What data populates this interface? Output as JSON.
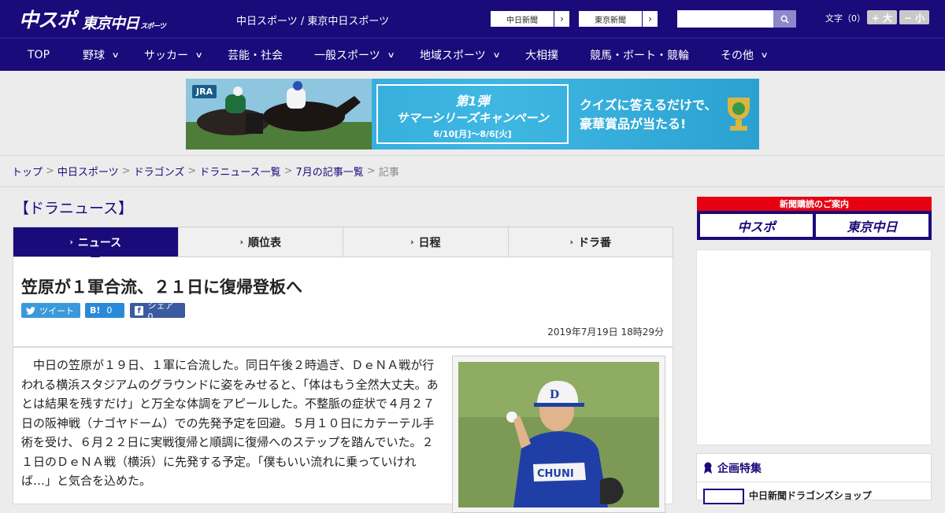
{
  "header": {
    "logo_main": "中スポ",
    "logo_sub": "東京中日",
    "logo_sub_small": "スポーツ",
    "site_names": "中日スポーツ / 東京中日スポーツ",
    "paper_buttons": [
      "中日新聞",
      "東京新聞"
    ],
    "search": {
      "placeholder": ""
    },
    "fontsize_label": "文字（0）",
    "fontsize_larger": "+ 大",
    "fontsize_smaller": "− 小"
  },
  "nav": [
    {
      "label": "TOP",
      "has_menu": false
    },
    {
      "label": "野球",
      "has_menu": true
    },
    {
      "label": "サッカー",
      "has_menu": true
    },
    {
      "label": "芸能・社会",
      "has_menu": false
    },
    {
      "label": "一般スポーツ",
      "has_menu": true
    },
    {
      "label": "地域スポーツ",
      "has_menu": true
    },
    {
      "label": "大相撲",
      "has_menu": false
    },
    {
      "label": "競馬・ボート・競輪",
      "has_menu": false
    },
    {
      "label": "その他",
      "has_menu": true
    }
  ],
  "banner": {
    "jra": "JRA",
    "campaign_line1": "第1弾",
    "campaign_line2": "サマーシリーズキャンペーン",
    "campaign_dates": "6/10[月]〜8/6[火]",
    "quiz_line1": "クイズに答えるだけで、",
    "quiz_line2": "豪華賞品が当たる!"
  },
  "breadcrumb": [
    {
      "label": "トップ",
      "link": true
    },
    {
      "label": "中日スポーツ",
      "link": true
    },
    {
      "label": "ドラゴンズ",
      "link": true
    },
    {
      "label": "ドラニュース一覧",
      "link": true
    },
    {
      "label": "7月の記事一覧",
      "link": true
    },
    {
      "label": "記事",
      "link": false
    }
  ],
  "section_title": "【ドラニュース】",
  "tabs": [
    {
      "label": "ニュース",
      "active": true
    },
    {
      "label": "順位表",
      "active": false
    },
    {
      "label": "日程",
      "active": false
    },
    {
      "label": "ドラ番",
      "active": false
    }
  ],
  "article": {
    "headline": "笠原が１軍合流、２１日に復帰登板へ",
    "share": {
      "tweet": "ツイート",
      "hatena": "0",
      "facebook": "シェア 0"
    },
    "date": "2019年7月19日 18時29分",
    "body": "中日の笠原が１９日、１軍に合流した。同日午後２時過ぎ、ＤｅＮＡ戦が行われる横浜スタジアムのグラウンドに姿をみせると、「体はもう全然大丈夫。あとは結果を残すだけ」と万全な体調をアピールした。不整脈の症状で４月２７日の阪神戦（ナゴヤドーム）での先発予定を回避。５月１０日にカテーテル手術を受け、６月２２日に実戦復帰と順調に復帰へのステップを踏んでいた。２１日のＤｅＮＡ戦（横浜）に先発する予定。「僕もいい流れに乗っていければ…」と気合を込めた。"
  },
  "sidebar": {
    "subscribe_title": "新聞購読のご案内",
    "subscribe_buttons": [
      "中スポ",
      "東京中日"
    ],
    "feature_title": "企画特集",
    "feature_item": "中日新聞ドラゴンズショップ"
  },
  "colors": {
    "brand": "#1a0a7a",
    "accent_red": "#e60012"
  }
}
